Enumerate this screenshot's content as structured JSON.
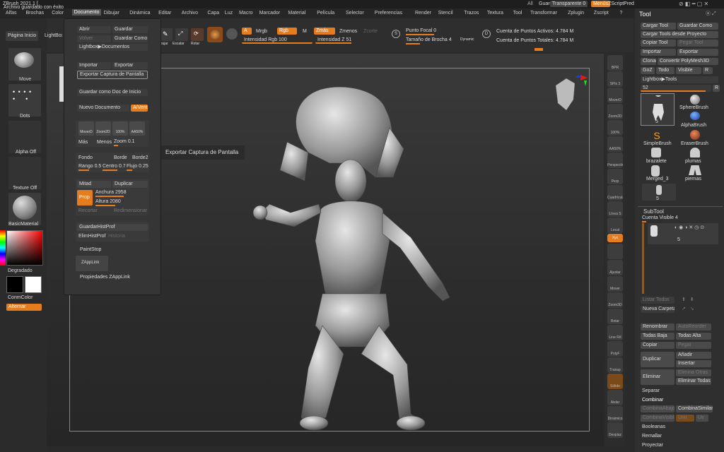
{
  "title": "ZBrush 2021.1 [",
  "notification": "Archivo guardado con éxito",
  "topright": {
    "all": "All",
    "quick_save": "Guard Rápido",
    "transparent": "Transparente 0",
    "menus": "Menús",
    "zscript": "ZScriptPred"
  },
  "menus": [
    "Alfas",
    "Brochas",
    "Color",
    "Documento",
    "Dibujar",
    "Dinámica",
    "Editar",
    "Archivo",
    "Capa",
    "Luz",
    "Macro",
    "Marcador",
    "Material",
    "Película",
    "Selector",
    "Preferencias",
    "Render",
    "Stencil",
    "Trazos",
    "Textura",
    "Tool",
    "Transformar",
    "Zplugin",
    "Zscript",
    "?"
  ],
  "left": {
    "home": "Página Inicio",
    "lightbox": "LightBox",
    "brush": "Move",
    "dots": "Dots",
    "alpha": "Alpha Off",
    "texture": "Texture Off",
    "material": "BasicMaterial",
    "gradient": "Degradado",
    "switch_color": "ConmColor",
    "alternate": "Alternar"
  },
  "toolbar": {
    "mrgb": "Mrgb",
    "rgb": "Rgb",
    "m": "M",
    "a": "A",
    "rgb_intensity": "Intensidad Rgb 100",
    "rgb_intensity_level": 1.0,
    "zadd": "Zmás",
    "zsub": "Zmenos",
    "zcut": "Zcorte",
    "z_intensity": "Intensidad Z 51",
    "z_intensity_level": 0.51,
    "focal": "Punto Focal 0",
    "brush_size": "Tamaño de Brocha 4",
    "dynamic": "Dynamic",
    "s": "S",
    "d": "D",
    "active_points": "Cuenta de Puntos Activos: 4.784 M",
    "total_points": "Cuenta de Puntos Totales: 4.784 M",
    "draw": "Dibujar",
    "move": "Mover",
    "scale": "Escalar",
    "rotate": "Rotar"
  },
  "docmenu": {
    "open": "Abrir",
    "save": "Guardar",
    "revert": "Volver",
    "save_as": "Guardar Como",
    "lightbox_docs": "Lightbox▶Documentos",
    "import": "Importar",
    "export": "Exportar",
    "export_screen": "Exportar Captura de Pantalla",
    "save_startup": "Guardar como Doc de Inicio",
    "new_doc": "Nuevo Documento",
    "wsize": "A/Vent",
    "move": "MoverD",
    "scale2d": "Zoom2D",
    "p100": "100%",
    "aahalf": "AA50%",
    "more": "Más",
    "less": "Menos",
    "zoom": "Zoom 0.1",
    "back": "Fondo",
    "border": "Borde",
    "border2": "Borde2",
    "range": "Rango 0.5",
    "range_level": 0.5,
    "center": "Centro 0.7",
    "center_level": 0.7,
    "flow": "Flujo 0.25",
    "flow_level": 0.25,
    "half": "Mitad",
    "double": "Duplicar",
    "prop": "Prop",
    "width": "Anchura 2958",
    "height": "Altura 2080",
    "resize": "Recortar",
    "redim": "Redimensionar",
    "save_hotprof": "GuardarHistProf",
    "del_hotprof": "ElimHistProf",
    "history": "Historia",
    "paintstop": "PaintStop",
    "zapplink": "ZAppLink",
    "zapplink_props": "Propiedades ZAppLink"
  },
  "tooltip": "Exportar Captura de Pantalla",
  "shelf": [
    "BPR",
    "SPix 3",
    "MoverD",
    "Zoom2D",
    "100%",
    "AA50%",
    "Perspectiva",
    "Perp",
    "Cuadrícula",
    "Línea S",
    "Local",
    "Xyz",
    "",
    "Ajustar",
    "Mover",
    "Zoom3D",
    "Rotar",
    "Line Fill",
    "PolyF",
    "Transp",
    "Sólido",
    "Aislar",
    "Dinámico",
    "Desplaz"
  ],
  "tool": {
    "title": "Tool",
    "load": "Cargar Tool",
    "save_as": "Guardar Como",
    "load_project": "Cargar Tools desde Proyecto",
    "copy": "Copiar Tool",
    "paste": "Pegar Tool",
    "import": "Importar",
    "export": "Exportar",
    "clone": "Clonar",
    "make_poly": "Convertir PolyMesh3D",
    "goz": "GoZ",
    "all": "Todo",
    "visible": "Visible",
    "r": "R",
    "lightbox_tools": "Lightbox▶Tools",
    "count": "52",
    "count_level": 0.92,
    "thumbs": [
      {
        "name": "5"
      },
      {
        "name": "SphereBrush"
      },
      {
        "name": "AlphaBrush"
      },
      {
        "name": "SimpleBrush"
      },
      {
        "name": "EraserBrush"
      },
      {
        "name": "brazalete"
      },
      {
        "name": "plumas"
      },
      {
        "name": "Merged_3"
      },
      {
        "name": "piernas"
      },
      {
        "name": "5"
      }
    ],
    "subtool": "SubTool",
    "visible_count": "Cuenta Visible 4",
    "sub_name": "5",
    "list_all": "Listar Todos",
    "new_folder": "Nueva Carpeta",
    "rename": "Renombrar",
    "autoreorder": "AutoReorder",
    "all_low": "Todas Baja",
    "all_high": "Todas Alta",
    "copy2": "Copiar",
    "paste2": "Pegar",
    "duplicate": "Duplicar",
    "append": "Añadir",
    "insert": "Insertar",
    "delete": "Eliminar",
    "del_other": "Elimina Otras",
    "del_all": "Eliminar Todas",
    "split": "Separar",
    "merge": "Combinar",
    "merge_down": "CombinaAbajo",
    "merge_similar": "CombinaSimilar",
    "merge_visible": "CombinaVisible",
    "weld": "Unir",
    "uv": "Uv",
    "boolean": "Booleanas",
    "remesh": "Remallar",
    "project": "Proyectar"
  }
}
